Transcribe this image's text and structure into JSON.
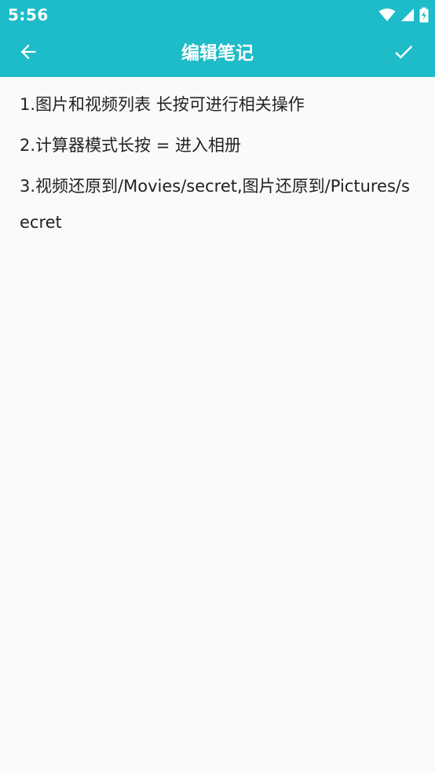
{
  "status_bar": {
    "time": "5:56",
    "icons": [
      "wifi-icon",
      "signal-icon",
      "battery-charging-icon"
    ]
  },
  "toolbar": {
    "title": "编辑笔记",
    "back_icon": "arrow-left-icon",
    "confirm_icon": "check-icon"
  },
  "note": {
    "lines": [
      "1.图片和视频列表 长按可进行相关操作",
      "2.计算器模式长按 = 进入相册",
      "3.视频还原到/Movies/secret,图片还原到/Pictures/secret"
    ]
  },
  "colors": {
    "accent": "#1dbcc8",
    "background": "#fafafa",
    "text": "#222222"
  }
}
